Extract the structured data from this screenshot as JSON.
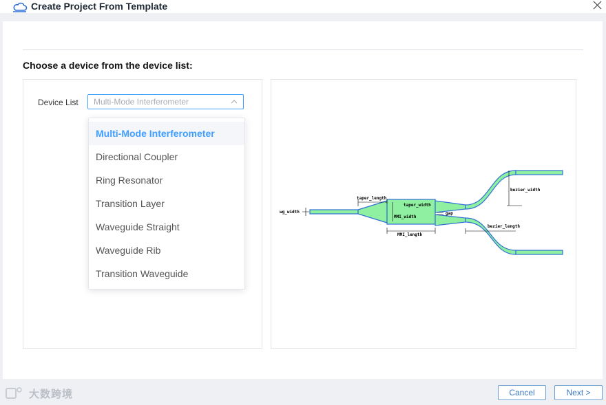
{
  "window": {
    "title": "Create Project From Template"
  },
  "page": {
    "heading": "Choose a device from the device list:"
  },
  "device_list": {
    "label": "Device List",
    "selected_value": "Multi-Mode Interferometer",
    "options": [
      "Multi-Mode Interferometer",
      "Directional Coupler",
      "Ring Resonator",
      "Transition Layer",
      "Waveguide Straight",
      "Waveguide Rib",
      "Transition Waveguide"
    ]
  },
  "diagram": {
    "labels": {
      "wg_width": "wg_width",
      "taper_length": "taper_length",
      "taper_width": "taper_width",
      "mmi_width": "MMI_width",
      "mmi_length": "MMI_length",
      "gap": "gap",
      "bezier_width": "bezier_width",
      "bezier_length": "bezier_length"
    },
    "colors": {
      "fill": "#8ef0a0",
      "stroke": "#2f6fd6"
    }
  },
  "footer": {
    "cancel_label": "Cancel",
    "next_label": "Next >"
  },
  "watermark": {
    "text": "大数跨境"
  }
}
